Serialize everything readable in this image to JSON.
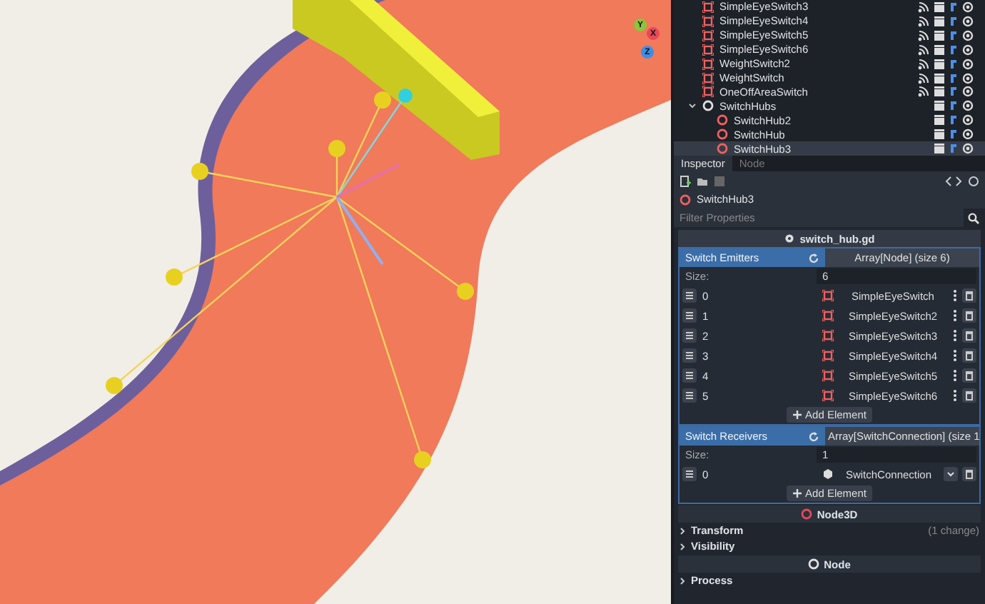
{
  "viewport": {
    "gizmo": [
      {
        "axis": "Y",
        "color": "#8dc43c"
      },
      {
        "axis": "X",
        "color": "#e8485a"
      },
      {
        "axis": "Z",
        "color": "#3a8ee8"
      }
    ]
  },
  "scene_tree": {
    "items": [
      {
        "name": "SimpleEyeSwitch3",
        "kind": "switch",
        "signals": true,
        "selected": false
      },
      {
        "name": "SimpleEyeSwitch4",
        "kind": "switch",
        "signals": true,
        "selected": false
      },
      {
        "name": "SimpleEyeSwitch5",
        "kind": "switch",
        "signals": true,
        "selected": false
      },
      {
        "name": "SimpleEyeSwitch6",
        "kind": "switch",
        "signals": true,
        "selected": false
      },
      {
        "name": "WeightSwitch2",
        "kind": "switch",
        "signals": true,
        "selected": false
      },
      {
        "name": "WeightSwitch",
        "kind": "switch",
        "signals": true,
        "selected": false
      },
      {
        "name": "OneOffAreaSwitch",
        "kind": "switch",
        "signals": true,
        "selected": false
      },
      {
        "name": "SwitchHubs",
        "kind": "node",
        "signals": false,
        "selected": false,
        "expanded": true,
        "children": [
          {
            "name": "SwitchHub2",
            "kind": "hub",
            "signals": false,
            "selected": false
          },
          {
            "name": "SwitchHub",
            "kind": "hub",
            "signals": false,
            "selected": false
          },
          {
            "name": "SwitchHub3",
            "kind": "hub",
            "signals": false,
            "selected": true
          }
        ]
      }
    ]
  },
  "inspector": {
    "tabs": [
      {
        "label": "Inspector",
        "selected": true
      },
      {
        "label": "Node",
        "selected": false
      }
    ],
    "node_selector": "SwitchHub3",
    "filter": {
      "placeholder": "Filter Properties"
    },
    "script_header": "switch_hub.gd",
    "arrays": [
      {
        "label": "Switch Emitters",
        "value": "Array[Node] (size 6)",
        "size_label": "Size:",
        "size": "6",
        "add_label": "Add Element",
        "elements": [
          {
            "index": "0",
            "name": "SimpleEyeSwitch",
            "kind": "node"
          },
          {
            "index": "1",
            "name": "SimpleEyeSwitch2",
            "kind": "node"
          },
          {
            "index": "2",
            "name": "SimpleEyeSwitch3",
            "kind": "node"
          },
          {
            "index": "3",
            "name": "SimpleEyeSwitch4",
            "kind": "node"
          },
          {
            "index": "4",
            "name": "SimpleEyeSwitch5",
            "kind": "node"
          },
          {
            "index": "5",
            "name": "SimpleEyeSwitch6",
            "kind": "node"
          }
        ]
      },
      {
        "label": "Switch Receivers",
        "value": "Array[SwitchConnection] (size 1",
        "size_label": "Size:",
        "size": "1",
        "add_label": "Add Element",
        "elements": [
          {
            "index": "0",
            "name": "SwitchConnection",
            "kind": "resource"
          }
        ]
      }
    ],
    "sections": [
      {
        "kind": "class",
        "label": "Node3D",
        "color": "#e8485a"
      },
      {
        "kind": "group",
        "label": "Transform",
        "note": "(1 change)"
      },
      {
        "kind": "group",
        "label": "Visibility"
      },
      {
        "kind": "class",
        "label": "Node",
        "color": "#e0e0e0"
      },
      {
        "kind": "group",
        "label": "Process"
      }
    ]
  }
}
